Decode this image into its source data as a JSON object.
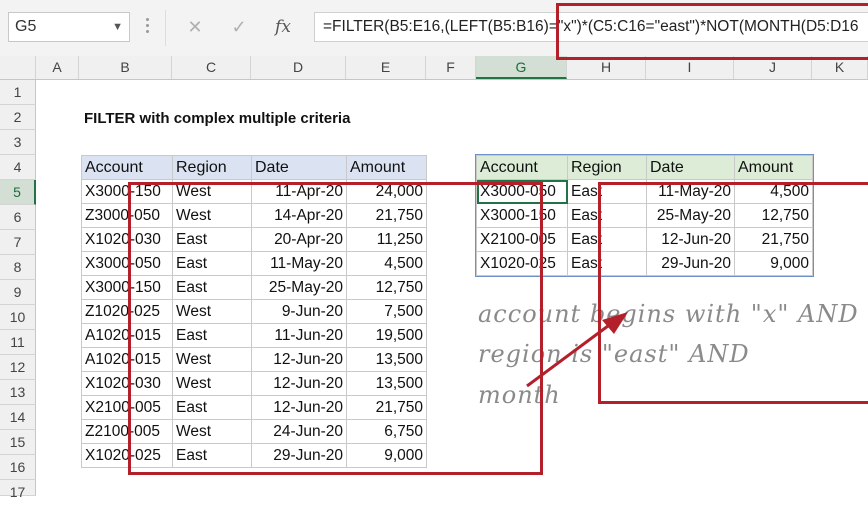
{
  "formula_bar": {
    "name_box": "G5",
    "cancel_icon": "✕",
    "enter_icon": "✓",
    "fx_label": "fx",
    "formula": "=FILTER(B5:E16,(LEFT(B5:B16)=\"x\")*(C5:C16=\"east\")*NOT(MONTH(D5:D16"
  },
  "columns": [
    "A",
    "B",
    "C",
    "D",
    "E",
    "F",
    "G",
    "H",
    "I",
    "J",
    "K"
  ],
  "rows": [
    "1",
    "2",
    "3",
    "4",
    "5",
    "6",
    "7",
    "8",
    "9",
    "10",
    "11",
    "12",
    "13",
    "14",
    "15",
    "16",
    "17"
  ],
  "selected_column": "G",
  "selected_row": "5",
  "title": "FILTER with complex multiple criteria",
  "source_table": {
    "headers": [
      "Account",
      "Region",
      "Date",
      "Amount"
    ],
    "rows": [
      [
        "X3000-150",
        "West",
        "11-Apr-20",
        "24,000"
      ],
      [
        "Z3000-050",
        "West",
        "14-Apr-20",
        "21,750"
      ],
      [
        "X1020-030",
        "East",
        "20-Apr-20",
        "11,250"
      ],
      [
        "X3000-050",
        "East",
        "11-May-20",
        "4,500"
      ],
      [
        "X3000-150",
        "East",
        "25-May-20",
        "12,750"
      ],
      [
        "Z1020-025",
        "West",
        "9-Jun-20",
        "7,500"
      ],
      [
        "A1020-015",
        "East",
        "11-Jun-20",
        "19,500"
      ],
      [
        "A1020-015",
        "West",
        "12-Jun-20",
        "13,500"
      ],
      [
        "X1020-030",
        "West",
        "12-Jun-20",
        "13,500"
      ],
      [
        "X2100-005",
        "East",
        "12-Jun-20",
        "21,750"
      ],
      [
        "Z2100-005",
        "West",
        "24-Jun-20",
        "6,750"
      ],
      [
        "X1020-025",
        "East",
        "29-Jun-20",
        "9,000"
      ]
    ]
  },
  "result_table": {
    "headers": [
      "Account",
      "Region",
      "Date",
      "Amount"
    ],
    "rows": [
      [
        "X3000-050",
        "East",
        "11-May-20",
        "4,500"
      ],
      [
        "X3000-150",
        "East",
        "25-May-20",
        "12,750"
      ],
      [
        "X2100-005",
        "East",
        "12-Jun-20",
        "21,750"
      ],
      [
        "X1020-025",
        "East",
        "29-Jun-20",
        "9,000"
      ]
    ]
  },
  "annotation": {
    "line1": "account begins with \"x\" AND",
    "line2": "region is \"east\" AND",
    "line3": "month"
  },
  "colors": {
    "highlight_red": "#b3202a",
    "source_header": "#dbe3f3",
    "result_header": "#dcecd6",
    "excel_green": "#217346"
  }
}
